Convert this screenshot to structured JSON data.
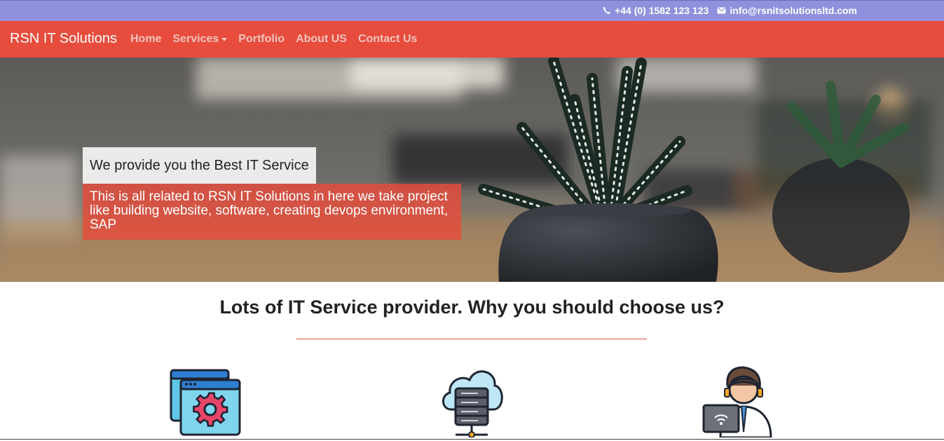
{
  "topbar": {
    "phone": "+44 (0) 1582 123 123",
    "email": "info@rsnitsolutionsltd.com",
    "phone_icon": "phone-icon",
    "email_icon": "envelope-icon"
  },
  "navbar": {
    "brand": "RSN IT Solutions",
    "items": [
      {
        "label": "Home"
      },
      {
        "label": "Services"
      },
      {
        "label": "Portfolio"
      },
      {
        "label": "About US"
      },
      {
        "label": "Contact Us"
      }
    ]
  },
  "hero": {
    "title": "We provide you the Best IT Service",
    "text": "This is all related to RSN IT Solutions in here we take project like building website, software, creating devops environment, SAP"
  },
  "why": {
    "heading": "Lots of IT Service provider. Why you should choose us?"
  },
  "features": [
    {
      "icon": "web-settings-icon"
    },
    {
      "icon": "cloud-server-icon"
    },
    {
      "icon": "support-agent-icon"
    }
  ],
  "colors": {
    "topbar": "#8f91dc",
    "navbar": "#e74c3c",
    "accent": "#e74c3c"
  }
}
